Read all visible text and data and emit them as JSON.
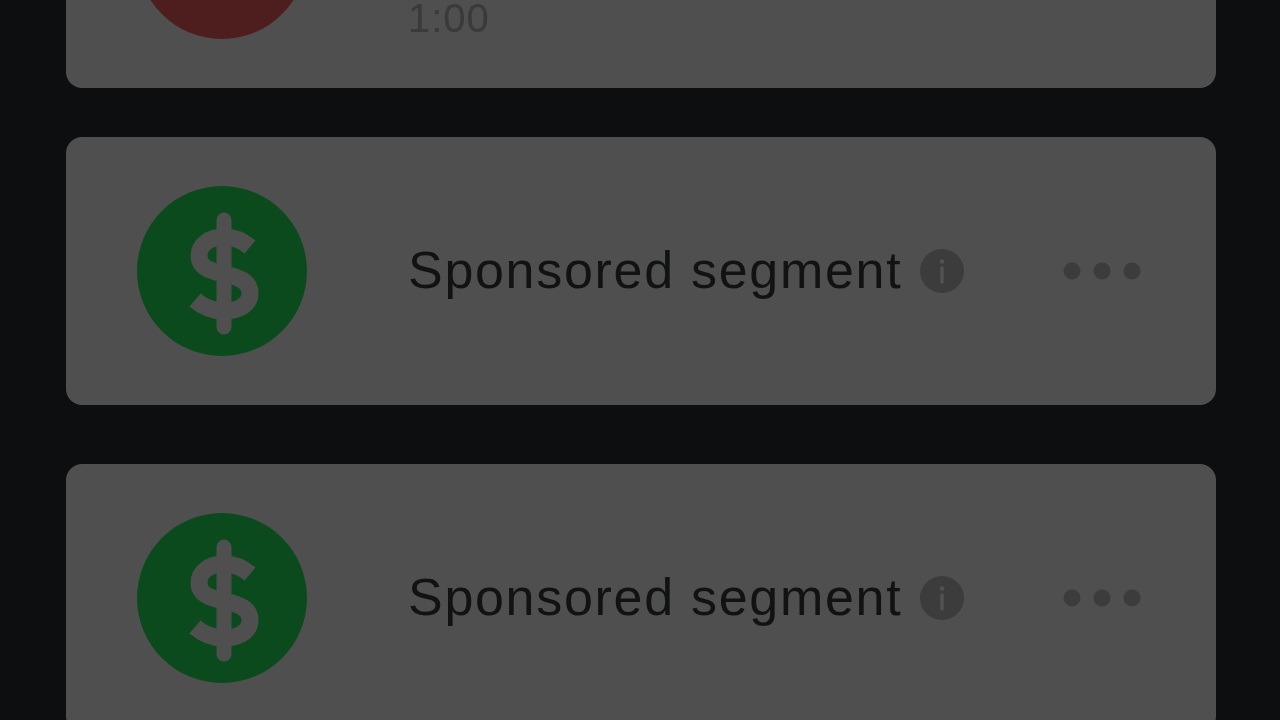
{
  "segments": [
    {
      "kind": "time",
      "color": "#4e1d1d",
      "time": "1:00"
    },
    {
      "kind": "sponsor",
      "color": "#0b4a1c",
      "label": "Sponsored segment"
    },
    {
      "kind": "sponsor",
      "color": "#0b4a1c",
      "label": "Sponsored segment"
    }
  ]
}
